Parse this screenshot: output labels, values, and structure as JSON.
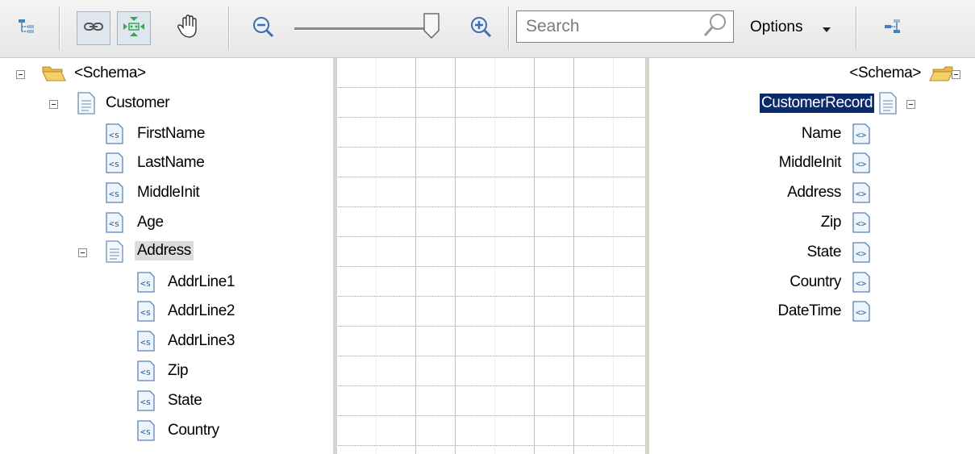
{
  "toolbar": {
    "search_placeholder": "Search",
    "options_label": "Options"
  },
  "icons": {
    "schema_view": "tree-view-icon",
    "link": "link-icon",
    "expand_links": "expand-links-icon",
    "pan": "hand-icon",
    "zoom_out": "zoom-out-icon",
    "zoom_in": "zoom-in-icon",
    "search": "magnifier-icon",
    "grid_view": "grid-icon"
  },
  "zoom": {
    "level_fraction": 1.0
  },
  "source_tree": {
    "root": "<Schema>",
    "record": "Customer",
    "fields": [
      "FirstName",
      "LastName",
      "MiddleInit",
      "Age"
    ],
    "address": "Address",
    "address_fields": [
      "AddrLine1",
      "AddrLine2",
      "AddrLine3",
      "Zip",
      "State",
      "Country"
    ]
  },
  "destination_tree": {
    "root": "<Schema>",
    "record": "CustomerRecord",
    "fields": [
      "Name",
      "MiddleInit",
      "Address",
      "Zip",
      "State",
      "Country",
      "DateTime"
    ]
  },
  "colors": {
    "selection_blue": "#0b2a6b",
    "selection_grey": "#dcdcdc",
    "grid_line": "#bdbdbd"
  }
}
